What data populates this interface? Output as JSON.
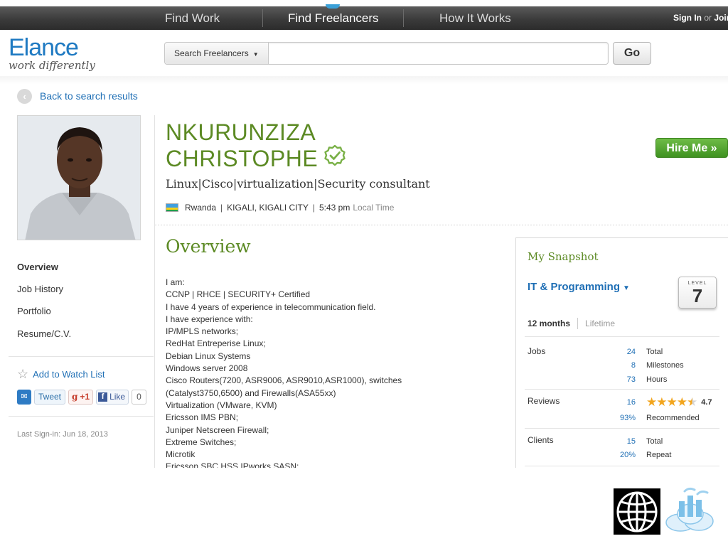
{
  "topnav": {
    "items": [
      "Find Work",
      "Find Freelancers",
      "How It Works"
    ],
    "signin": "Sign In",
    "or": "or",
    "join": "Join"
  },
  "header": {
    "logo_word": "Elance",
    "logo_tagline": "work differently",
    "search_scope": "Search Freelancers",
    "search_value": "",
    "go_label": "Go"
  },
  "back_label": "Back to search results",
  "profile": {
    "name_line1": "NKURUNZIZA",
    "name_line2": "CHRISTOPHE",
    "subtitle": "Linux|Cisco|virtualization|Security consultant",
    "country": "Rwanda",
    "city": "KIGALI, KIGALI CITY",
    "time": "5:43 pm",
    "time_suffix": "Local Time",
    "hire_label": "Hire Me »"
  },
  "left_nav": {
    "items": [
      "Overview",
      "Job History",
      "Portfolio",
      "Resume/C.V."
    ],
    "watch_label": "Add to Watch List",
    "tweet": "Tweet",
    "gplus": "+1",
    "like": "Like",
    "like_count": "0",
    "last_signin": "Last Sign-in: Jun 18, 2013"
  },
  "overview": {
    "title": "Overview",
    "lines": [
      "I am:",
      "CCNP | RHCE | SECURITY+ Certified",
      "I have 4 years of experience in telecommunication field.",
      "I have experience with:",
      "IP/MPLS networks;",
      "RedHat Entreperise Linux;",
      "Debian Linux Systems",
      "Windows server 2008",
      "Cisco Routers(7200, ASR9006, ASR9010,ASR1000), switches",
      "(Catalyst3750,6500) and Firewalls(ASA55xx)",
      "Virtualization (VMware, KVM)",
      "Ericsson IMS PBN;",
      "Juniper Netscreen Firewall;",
      "Extreme Switches;",
      "Microtik",
      "Ericsson SBC HSS IPworks SASN;"
    ]
  },
  "snapshot": {
    "title": "My Snapshot",
    "category": "IT & Programming",
    "level_label": "LEVEL",
    "level": "7",
    "period_active": "12 months",
    "period_other": "Lifetime",
    "jobs_label": "Jobs",
    "jobs_total": "24",
    "jobs_total_label": "Total",
    "milestones": "8",
    "milestones_label": "Milestones",
    "hours": "73",
    "hours_label": "Hours",
    "reviews_label": "Reviews",
    "reviews_count": "16",
    "rating": "4.7",
    "recommended": "93%",
    "recommended_label": "Recommended",
    "clients_label": "Clients",
    "clients_total": "15",
    "clients_total_label": "Total",
    "repeat": "20%",
    "repeat_label": "Repeat"
  },
  "colors": {
    "accent_green": "#5c8a24",
    "link_blue": "#1f6fb5",
    "hire_green": "#4fa12c",
    "star": "#f2a51e"
  }
}
